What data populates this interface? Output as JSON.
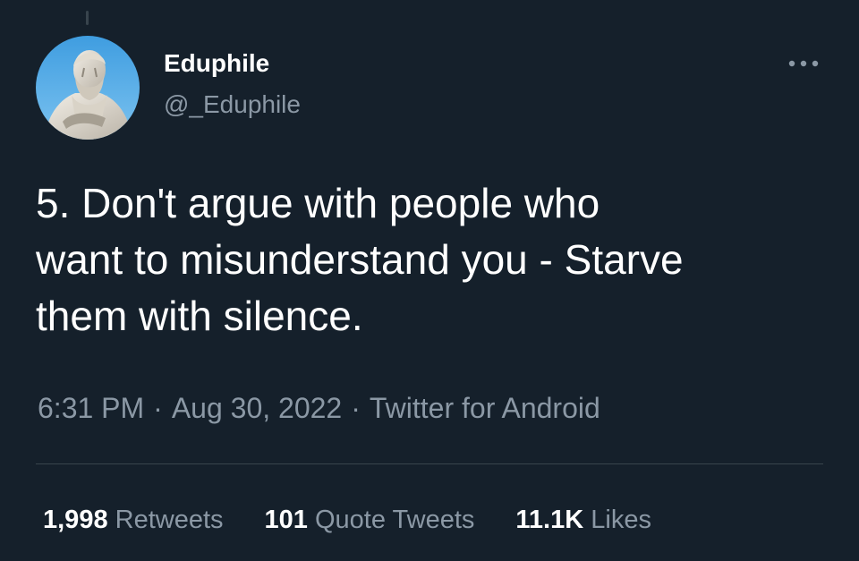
{
  "tweet": {
    "author": {
      "display_name": "Eduphile",
      "handle": "@_Eduphile",
      "avatar_icon": "marble-statue-avatar"
    },
    "more_icon": "ellipsis-icon",
    "text": "5.  Don't argue with people who\nwant to misunderstand you - Starve\nthem with silence.",
    "time": "6:31 PM",
    "date": "Aug 30, 2022",
    "source": "Twitter for Android",
    "separator": "·",
    "stats": {
      "retweets_count": "1,998",
      "retweets_label": "Retweets",
      "quote_tweets_count": "101",
      "quote_tweets_label": "Quote Tweets",
      "likes_count": "11.1K",
      "likes_label": "Likes"
    }
  },
  "colors": {
    "background": "#15202b",
    "primary_text": "#ffffff",
    "secondary_text": "#8b98a5",
    "divider": "#38444d"
  }
}
